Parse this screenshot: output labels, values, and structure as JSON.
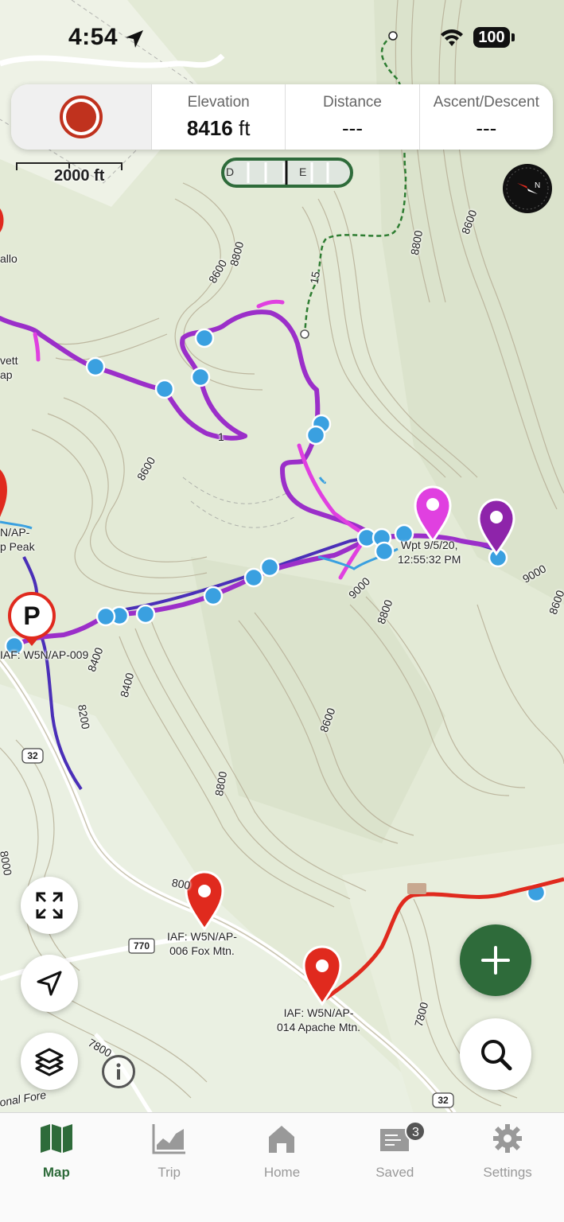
{
  "status_bar": {
    "time": "4:54",
    "battery": "100"
  },
  "stats": {
    "elevation": {
      "label": "Elevation",
      "value": "8416",
      "unit": "ft"
    },
    "distance": {
      "label": "Distance",
      "value": "---"
    },
    "ascent_descent": {
      "label": "Ascent/Descent",
      "value": "---"
    }
  },
  "scale_bar": {
    "label": "2000 ft"
  },
  "heading_strip": {
    "marks": [
      "D",
      "E"
    ]
  },
  "map_labels": {
    "contours": [
      "8800",
      "8800",
      "8600",
      "8600",
      "8600",
      "8600",
      "8400",
      "8400",
      "8200",
      "9000",
      "9000",
      "8800",
      "8800",
      "8600",
      "8000",
      "800",
      "7800",
      "7800",
      "1",
      "15"
    ],
    "waypoint": "Wpt 9/5/20,\n12:55:32 PM",
    "iaf_009": "IAF: W5N/AP-009",
    "iaf_006": "IAF: W5N/AP-\n006 Fox Mtn.",
    "iaf_014": "IAF: W5N/AP-\n014 Apache Mtn.",
    "left_peak": "N/AP-\np Peak",
    "left_llo": "allo",
    "left_vett": "vett\nap",
    "road_32a": "32",
    "road_32b": "32",
    "road_770": "770",
    "national_forest": "ional Fore",
    "parking": "P"
  },
  "tabs": [
    {
      "label": "Map",
      "icon": "map-icon",
      "active": true
    },
    {
      "label": "Trip",
      "icon": "chart-icon",
      "active": false
    },
    {
      "label": "Home",
      "icon": "home-icon",
      "active": false
    },
    {
      "label": "Saved",
      "icon": "saved-icon",
      "active": false,
      "badge": "3"
    },
    {
      "label": "Settings",
      "icon": "gear-icon",
      "active": false
    }
  ],
  "colors": {
    "accent_green": "#2e6b3a",
    "record_red": "#c0321e",
    "track_purple": "#9b2fc9",
    "track_pink": "#e040e0",
    "route_blue": "#4a2fb8",
    "waypoint_blue": "#3aa0e0",
    "road_red": "#e02a1e"
  }
}
